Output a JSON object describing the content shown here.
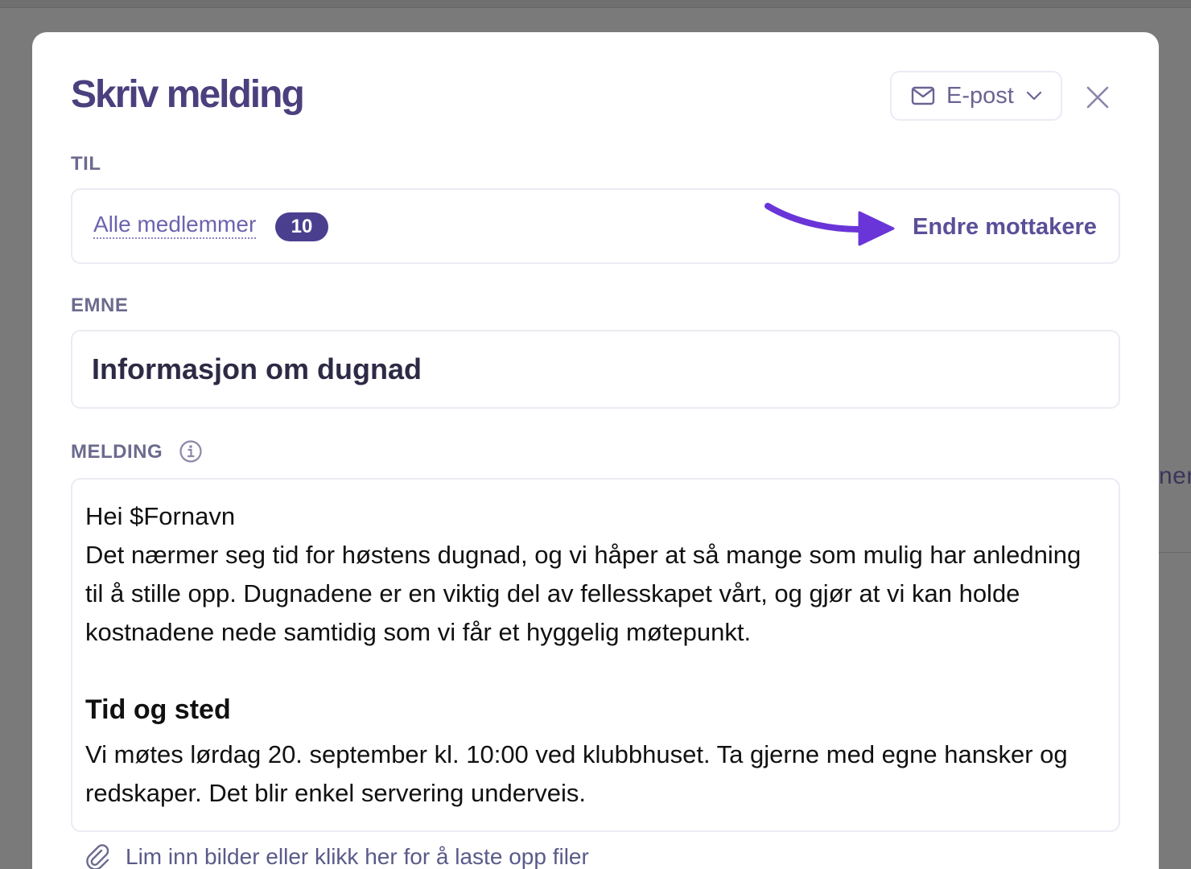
{
  "background": {
    "peek_text": "ner"
  },
  "modal": {
    "title": "Skriv melding",
    "channel": {
      "selected": "E-post",
      "icon": "mail-icon",
      "dropdown_icon": "chevron-down-icon"
    },
    "close_icon": "close-icon"
  },
  "to": {
    "label": "TIL",
    "recipients_label": "Alle medlemmer",
    "recipients_count": "10",
    "change_label": "Endre mottakere",
    "arrow_color": "#6a35d8"
  },
  "subject": {
    "label": "EMNE",
    "value": "Informasjon om dugnad"
  },
  "message": {
    "label": "MELDING",
    "info_icon": "info-icon",
    "greeting": "Hei $Fornavn",
    "intro": "Det nærmer seg tid for høstens dugnad, og vi håper at så mange som mulig har anledning til å stille opp. Dugnadene er en viktig del av fellesskapet vårt, og gjør at vi kan holde kostnadene nede samtidig som vi får et hyggelig møtepunkt.",
    "heading": "Tid og sted",
    "details": "Vi møtes lørdag 20. september kl. 10:00 ved klubbhuset. Ta gjerne med egne hansker og redskaper. Det blir enkel servering underveis."
  },
  "attachments": {
    "icon": "paperclip-icon",
    "label": "Lim inn bilder eller klikk her for å laste opp filer"
  },
  "colors": {
    "accent": "#4a3f8f",
    "title": "#4b3f7e",
    "overlay": "#7a7a7a"
  }
}
